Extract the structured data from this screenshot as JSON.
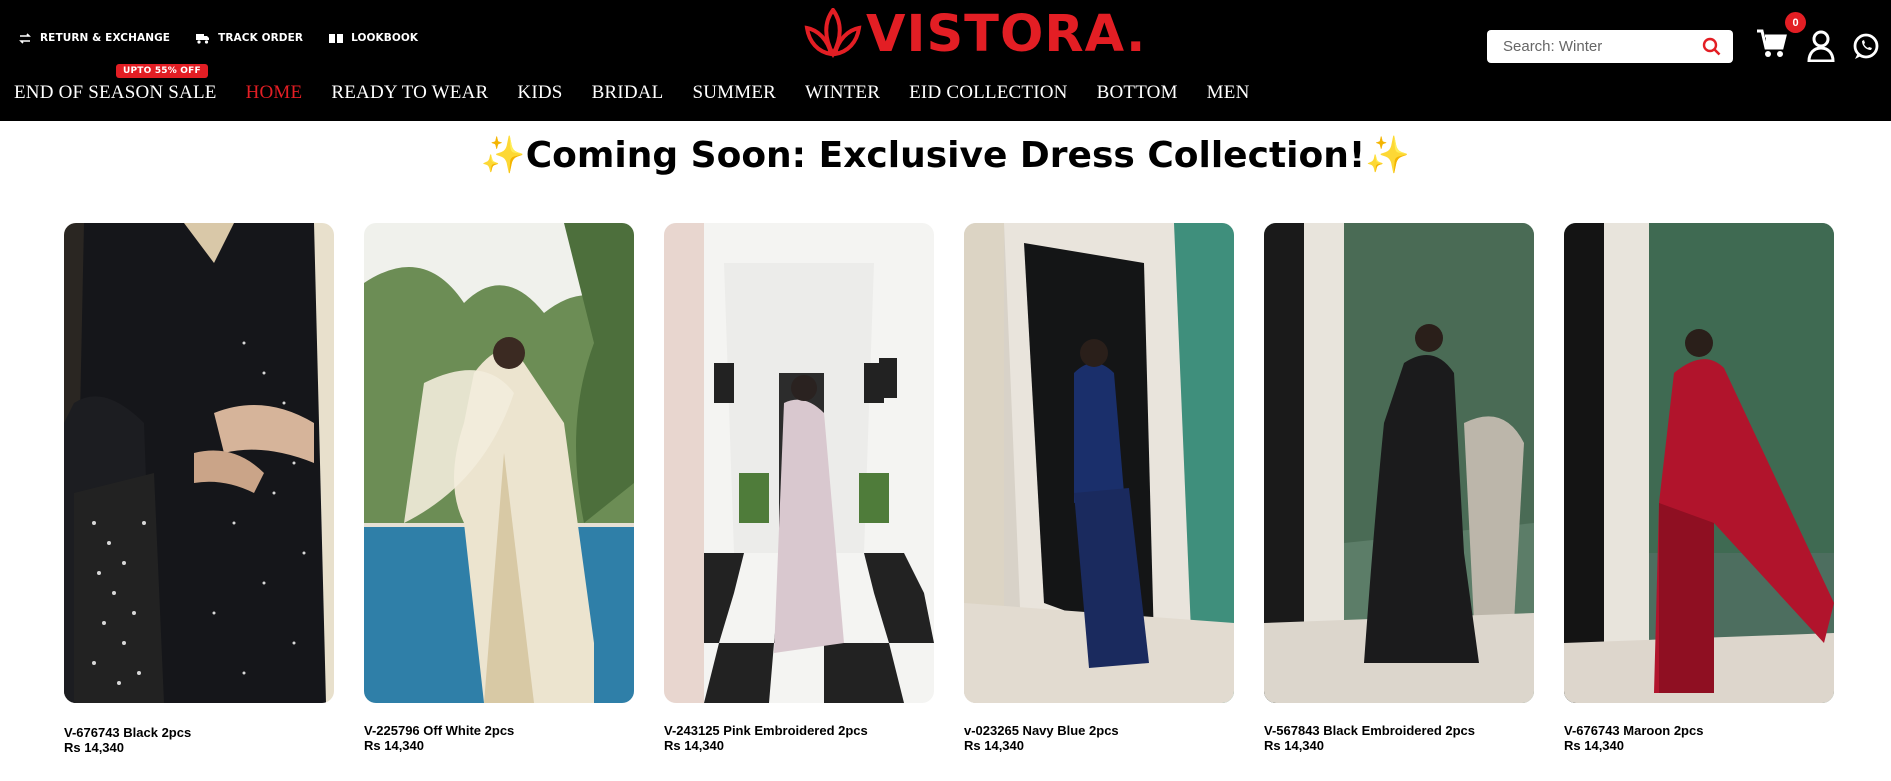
{
  "top_links": [
    {
      "label": "RETURN & EXCHANGE",
      "icon": "exchange-icon"
    },
    {
      "label": "TRACK ORDER",
      "icon": "truck-icon"
    },
    {
      "label": "LOOKBOOK",
      "icon": "book-icon"
    }
  ],
  "brand": {
    "name": "VISTORA.",
    "color": "#e31e24"
  },
  "search": {
    "placeholder": "Search: Winter"
  },
  "cart": {
    "count": "0"
  },
  "nav": [
    {
      "label": "END OF SEASON SALE",
      "tag": "UPTO 55% OFF"
    },
    {
      "label": "HOME"
    },
    {
      "label": "READY TO WEAR"
    },
    {
      "label": "KIDS"
    },
    {
      "label": "BRIDAL"
    },
    {
      "label": "SUMMER"
    },
    {
      "label": "WINTER"
    },
    {
      "label": "EID COLLECTION"
    },
    {
      "label": "BOTTOM"
    },
    {
      "label": "MEN"
    }
  ],
  "heading": {
    "sparkle_left": "✨",
    "text": "Coming Soon: Exclusive Dress Collection!",
    "sparkle_right": "✨"
  },
  "products": [
    {
      "name": "V-676743 Black 2pcs",
      "price": "Rs 14,340"
    },
    {
      "name": "V-225796 Off White 2pcs",
      "price": "Rs 14,340"
    },
    {
      "name": "V-243125 Pink Embroidered 2pcs",
      "price": "Rs 14,340"
    },
    {
      "name": "v-023265 Navy Blue 2pcs",
      "price": "Rs 14,340"
    },
    {
      "name": "V-567843 Black Embroidered 2pcs",
      "price": "Rs 14,340"
    },
    {
      "name": "V-676743 Maroon 2pcs",
      "price": "Rs 14,340"
    }
  ],
  "colors": {
    "accent": "#e31e24",
    "header_bg": "#000000"
  }
}
